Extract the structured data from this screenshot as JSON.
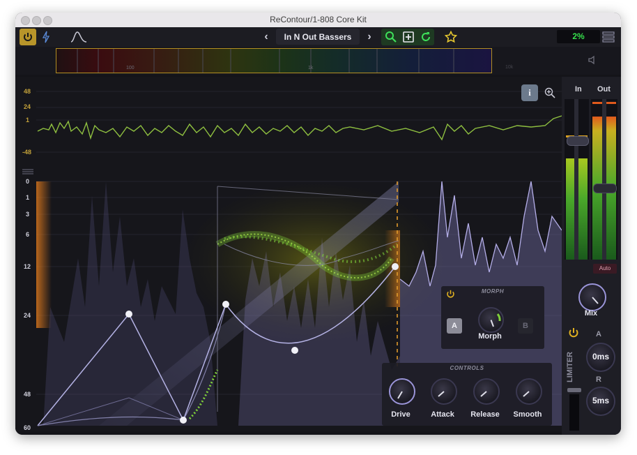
{
  "window": {
    "title": "ReContour/1-808 Core Kit"
  },
  "toolbar": {
    "preset_name": "In N Out Bassers",
    "prev_label": "‹",
    "next_label": "›",
    "cpu_percent": "2%"
  },
  "spectrum_bar": {
    "tick_100": "100",
    "tick_1k": "1k",
    "tick_10k": "10k"
  },
  "main": {
    "top_scale": [
      "48",
      "24",
      "1",
      "-48"
    ],
    "bottom_scale": [
      "0",
      "1",
      "3",
      "6",
      "12",
      "24",
      "48",
      "60"
    ],
    "info_label": "i"
  },
  "morph": {
    "title": "MORPH",
    "a_label": "A",
    "b_label": "B",
    "knob_label": "Morph"
  },
  "controls": {
    "title": "CONTROLS",
    "knobs": [
      {
        "label": "Drive"
      },
      {
        "label": "Attack"
      },
      {
        "label": "Release"
      },
      {
        "label": "Smooth"
      }
    ]
  },
  "meters": {
    "in_label": "In",
    "out_label": "Out",
    "auto_label": "Auto",
    "mix_label": "Mix"
  },
  "limiter": {
    "title": "LIMITER",
    "a_label": "A",
    "a_value": "0ms",
    "r_label": "R",
    "r_value": "5ms"
  },
  "colors": {
    "accent": "#c4a23a",
    "green": "#7fcf3a",
    "purple": "#8a84c8",
    "orange": "#e07a1c"
  }
}
